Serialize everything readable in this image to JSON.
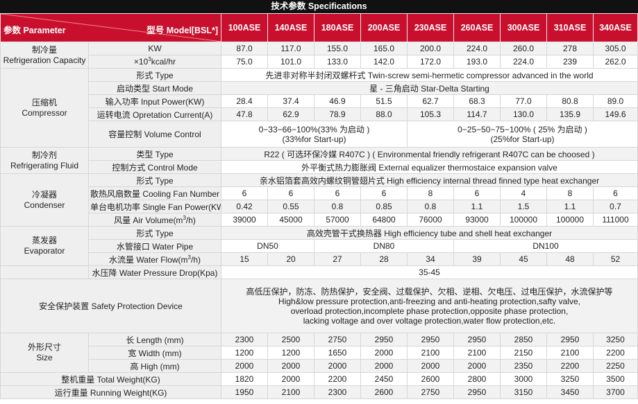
{
  "title": "技术参数 Specifications",
  "header": {
    "param_label": "参数 Parameter",
    "model_label": "型号 Model[BSL*]",
    "models": [
      "100ASE",
      "140ASE",
      "180ASE",
      "200ASE",
      "230ASE",
      "260ASE",
      "300ASE",
      "310ASE",
      "340ASE"
    ]
  },
  "refrigeration": {
    "group_cn": "制冷量",
    "group_en": "Refrigeration Capacity",
    "unit_kw": "KW",
    "unit_kcal_prefix": "×10",
    "unit_kcal_sup": "3",
    "unit_kcal_suffix": "kcal/hr",
    "kw": [
      "87.0",
      "117.0",
      "155.0",
      "165.0",
      "200.0",
      "224.0",
      "260.0",
      "278",
      "305.0"
    ],
    "kcal": [
      "75.0",
      "101.0",
      "133.0",
      "142.0",
      "172.0",
      "193.0",
      "224.0",
      "239",
      "262.0"
    ]
  },
  "compressor": {
    "group_cn": "压缩机",
    "group_en": "Compressor",
    "type_label": "形式 Type",
    "type_value": "先进非对称半封闭双螺杆式 Twin-screw semi-hermetic compressor advanced in the world",
    "start_label": "启动类型 Start Mode",
    "start_value": "星 - 三角启动 Star-Delta Starting",
    "power_label": "输入功率 Input Power(KW)",
    "power": [
      "28.4",
      "37.4",
      "46.9",
      "51.5",
      "62.7",
      "68.3",
      "77.0",
      "80.8",
      "89.0"
    ],
    "current_label": "运转电流 Opretation Current(A)",
    "current": [
      "47.8",
      "62.9",
      "78.9",
      "88.0",
      "105.3",
      "114.7",
      "130.0",
      "135.9",
      "149.6"
    ],
    "volume_label": "容量控制 Volume Control",
    "volume_a_1": "0−33−66−100%(33% 为启动 )",
    "volume_a_2": "(33%for Start-up)",
    "volume_b_1": "0−25−50−75−100% ( 25% 为启动 )",
    "volume_b_2": "(25%for Start-up)"
  },
  "refrigerant": {
    "group_cn": "制冷剂",
    "group_en": "Refrigerating Fluid",
    "type_label": "类型 Type",
    "type_value": "R22 ( 可选环保冷媒 R407C ) ( Environmental friendly refrigerant R407C can be choosed )",
    "control_label": "控制方式 Control Mode",
    "control_value": "外平衡式热力膨胀阀 External equalizer thermostaice expansion valve"
  },
  "condenser": {
    "group_cn": "冷凝器",
    "group_en": "Condenser",
    "type_label": "形式 Type",
    "type_value": "亲水铝箔套高效内螺纹铜管翅片式 High efficiency internal thread finned type heat exchanger",
    "fan_number_label": "散热风扇数量 Cooling Fan Number",
    "fan_number": [
      "6",
      "6",
      "6",
      "6",
      "8",
      "6",
      "4",
      "8",
      "6"
    ],
    "fan_power_label": "单台电机功率 Single Fan Power(KW)",
    "fan_power": [
      "0.42",
      "0.55",
      "0.8",
      "0.85",
      "0.8",
      "1.1",
      "1.5",
      "1.1",
      "0.7"
    ],
    "air_label_prefix": "风量 Air Volume(m",
    "air_label_sup": "3",
    "air_label_suffix": "/h)",
    "air_volume": [
      "39000",
      "45000",
      "57000",
      "64800",
      "76000",
      "93000",
      "100000",
      "100000",
      "111000"
    ]
  },
  "evaporator": {
    "group_cn": "蒸发器",
    "group_en": "Evaporator",
    "type_label": "形式 Type",
    "type_value": "高效壳管干式换热器 High efficiency tube and shell heat exchanger",
    "pipe_label": "水管接口 Water Pipe",
    "pipe_a": "DN50",
    "pipe_b": "DN80",
    "pipe_c": "DN100",
    "flow_label_prefix": "水流量 Water Flow(m",
    "flow_label_sup": "3",
    "flow_label_suffix": "/h)",
    "water_flow": [
      "15",
      "20",
      "27",
      "28",
      "34",
      "39",
      "45",
      "48",
      "52"
    ],
    "drop_label": "水压降 Water Pressure Drop(Kpa)",
    "drop_value": "35-45"
  },
  "safety": {
    "label": "安全保护装置 Safety Protection Device",
    "line1": "高低压保护，防冻、防热保护，安全阀、过载保护、欠相、逆相、欠电压、过电压保护，水流保护等",
    "line2": "High&low pressure protection,anti-freezing and anti-heating protection,safty valve,",
    "line3": "overload protection,incomplete phase protection,opposite phase protection,",
    "line4": "lacking voltage and over voltage protection,water flow protection,etc."
  },
  "size": {
    "group_cn": "外形尺寸",
    "group_en": "Size",
    "length_label": "长 Length (mm)",
    "length": [
      "2300",
      "2500",
      "2750",
      "2950",
      "2950",
      "2950",
      "2850",
      "2950",
      "3250"
    ],
    "width_label": "宽 Width (mm)",
    "width": [
      "1200",
      "1200",
      "1650",
      "2000",
      "2100",
      "2100",
      "2150",
      "2100",
      "2200"
    ],
    "height_label": "高 High (mm)",
    "height": [
      "2000",
      "2000",
      "2000",
      "2000",
      "2000",
      "2000",
      "2350",
      "2200",
      "2250"
    ]
  },
  "weight": {
    "total_label": "整机重量 Total Weight(KG)",
    "total": [
      "1820",
      "2000",
      "2200",
      "2450",
      "2600",
      "2800",
      "3000",
      "3250",
      "3500"
    ],
    "running_label": "运行重量 Running Weight(KG)",
    "running": [
      "1950",
      "2100",
      "2300",
      "2600",
      "2750",
      "2950",
      "3150",
      "3450",
      "3700"
    ]
  },
  "colors": {
    "header_red": "#c8102e",
    "title_black": "#111111",
    "label_grey": "#efefef"
  }
}
